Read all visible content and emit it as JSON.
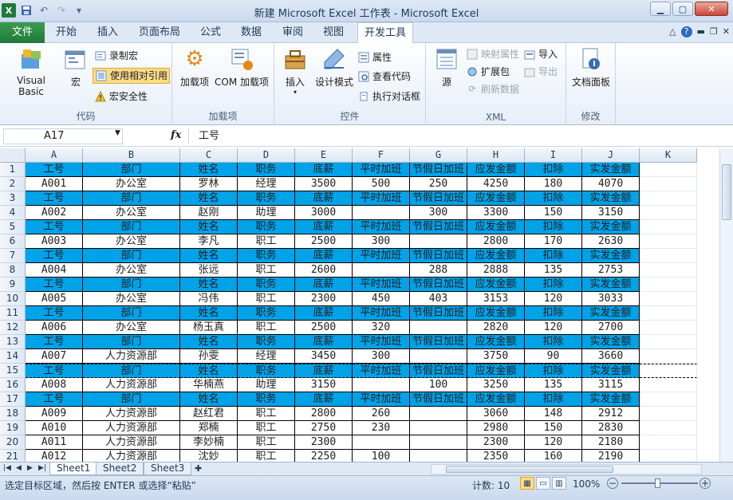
{
  "window": {
    "title": "新建 Microsoft Excel 工作表 - Microsoft Excel",
    "minimize_icon": "minimize-icon",
    "maximize_icon": "maximize-icon",
    "close_icon": "close-icon"
  },
  "ribbon_tabs": {
    "file": "文件",
    "items": [
      "开始",
      "插入",
      "页面布局",
      "公式",
      "数据",
      "审阅",
      "视图",
      "开发工具"
    ],
    "active": "开发工具"
  },
  "ribbon": {
    "code": {
      "label": "代码",
      "visual_basic": "Visual Basic",
      "macros": "宏",
      "record_macro": "录制宏",
      "use_relative": "使用相对引用",
      "macro_security": "宏安全性"
    },
    "addins": {
      "label": "加载项",
      "addins": "加载项",
      "com_addins": "COM 加载项"
    },
    "controls": {
      "label": "控件",
      "insert": "插入",
      "design_mode": "设计模式",
      "properties": "属性",
      "view_code": "查看代码",
      "run_dialog": "执行对话框"
    },
    "xml": {
      "label": "XML",
      "source": "源",
      "map_properties": "映射属性",
      "expansion_packs": "扩展包",
      "refresh_data": "刷新数据",
      "import": "导入",
      "export": "导出"
    },
    "modify": {
      "label": "修改",
      "document_panel": "文档面板"
    }
  },
  "formula_bar": {
    "name_box": "A17",
    "fx": "fx",
    "content": "工号"
  },
  "grid": {
    "columns": [
      "A",
      "B",
      "C",
      "D",
      "E",
      "F",
      "G",
      "H",
      "I",
      "J",
      "K"
    ],
    "header_row": [
      "工号",
      "部门",
      "姓名",
      "职务",
      "底薪",
      "平时加班",
      "节假日加班",
      "应发金额",
      "扣除",
      "实发金额"
    ],
    "row_numbers": [
      "1",
      "2",
      "3",
      "4",
      "5",
      "6",
      "7",
      "8",
      "9",
      "10",
      "11",
      "12",
      "13",
      "14",
      "15",
      "16",
      "17",
      "18",
      "19",
      "20",
      "21"
    ],
    "rows": [
      {
        "type": "header"
      },
      {
        "type": "data",
        "cells": [
          "A001",
          "办公室",
          "罗林",
          "经理",
          "3500",
          "500",
          "250",
          "4250",
          "180",
          "4070"
        ]
      },
      {
        "type": "header"
      },
      {
        "type": "data",
        "cells": [
          "A002",
          "办公室",
          "赵刚",
          "助理",
          "3000",
          "",
          "300",
          "3300",
          "150",
          "3150"
        ]
      },
      {
        "type": "header"
      },
      {
        "type": "data",
        "cells": [
          "A003",
          "办公室",
          "李凡",
          "职工",
          "2500",
          "300",
          "",
          "2800",
          "170",
          "2630"
        ]
      },
      {
        "type": "header"
      },
      {
        "type": "data",
        "cells": [
          "A004",
          "办公室",
          "张远",
          "职工",
          "2600",
          "",
          "288",
          "2888",
          "135",
          "2753"
        ]
      },
      {
        "type": "header"
      },
      {
        "type": "data",
        "cells": [
          "A005",
          "办公室",
          "冯伟",
          "职工",
          "2300",
          "450",
          "403",
          "3153",
          "120",
          "3033"
        ]
      },
      {
        "type": "header"
      },
      {
        "type": "data",
        "cells": [
          "A006",
          "办公室",
          "杨玉真",
          "职工",
          "2500",
          "320",
          "",
          "2820",
          "120",
          "2700"
        ]
      },
      {
        "type": "header"
      },
      {
        "type": "data",
        "cells": [
          "A007",
          "人力资源部",
          "孙雯",
          "经理",
          "3450",
          "300",
          "",
          "3750",
          "90",
          "3660"
        ]
      },
      {
        "type": "header",
        "marching": true
      },
      {
        "type": "data",
        "cells": [
          "A008",
          "人力资源部",
          "华楠燕",
          "助理",
          "3150",
          "",
          "100",
          "3250",
          "135",
          "3115"
        ]
      },
      {
        "type": "header"
      },
      {
        "type": "data",
        "cells": [
          "A009",
          "人力资源部",
          "赵红君",
          "职工",
          "2800",
          "260",
          "",
          "3060",
          "148",
          "2912"
        ]
      },
      {
        "type": "data",
        "cells": [
          "A010",
          "人力资源部",
          "郑楠",
          "职工",
          "2750",
          "230",
          "",
          "2980",
          "150",
          "2830"
        ]
      },
      {
        "type": "data",
        "cells": [
          "A011",
          "人力资源部",
          "李妙楠",
          "职工",
          "2300",
          "",
          "",
          "2300",
          "120",
          "2180"
        ]
      },
      {
        "type": "data",
        "cells": [
          "A012",
          "人力资源部",
          "沈妙",
          "职工",
          "2250",
          "100",
          "",
          "2350",
          "160",
          "2190"
        ]
      }
    ]
  },
  "sheets": {
    "tabs": [
      "Sheet1",
      "Sheet2",
      "Sheet3"
    ],
    "active": "Sheet1"
  },
  "status": {
    "message": "选定目标区域，然后按 ENTER 或选择“粘贴”",
    "count": "计数: 10",
    "zoom": "100%"
  },
  "colors": {
    "header_fill": "#00a2e8",
    "file_tab": "#1d7a3a"
  }
}
